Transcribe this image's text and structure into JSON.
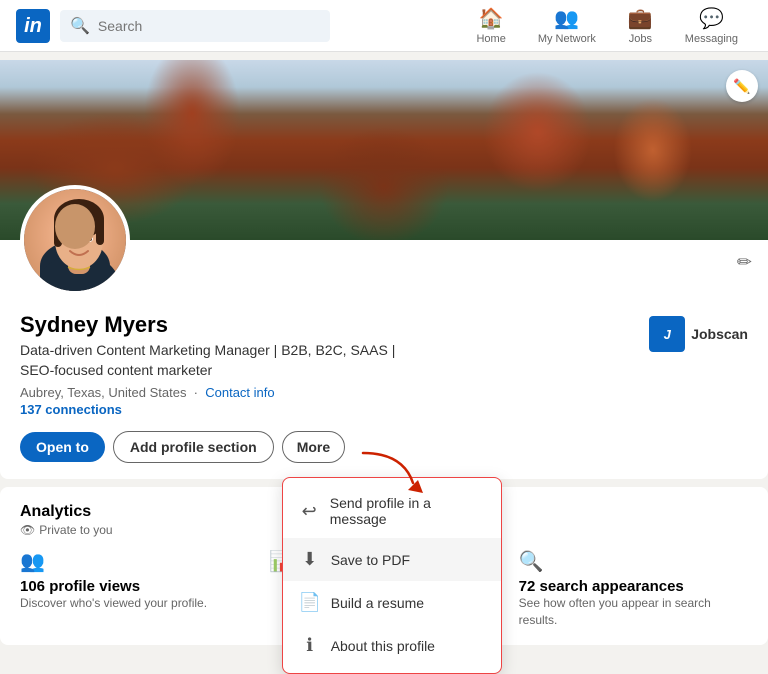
{
  "nav": {
    "logo": "in",
    "search_placeholder": "Search",
    "items": [
      {
        "label": "Home",
        "icon": "🏠"
      },
      {
        "label": "My Network",
        "icon": "👥"
      },
      {
        "label": "Jobs",
        "icon": "💼"
      },
      {
        "label": "Messaging",
        "icon": "💬"
      }
    ]
  },
  "profile": {
    "name": "Sydney Myers",
    "title": "Data-driven Content Marketing Manager | B2B, B2C, SAAS | SEO-focused content marketer",
    "location": "Aubrey, Texas, United States",
    "contact_info_label": "Contact info",
    "connections": "137 connections",
    "company": "Jobscan",
    "edit_label": "✏",
    "banner_edit_label": "✏"
  },
  "buttons": {
    "open_to": "Open to",
    "add_profile_section": "Add profile section",
    "more": "More"
  },
  "dropdown": {
    "items": [
      {
        "icon": "↩",
        "label": "Send profile in a message"
      },
      {
        "icon": "⬇",
        "label": "Save to PDF",
        "highlighted": true
      },
      {
        "icon": "📄",
        "label": "Build a resume"
      },
      {
        "icon": "ℹ",
        "label": "About this profile"
      }
    ]
  },
  "analytics": {
    "title": "Analytics",
    "subtitle": "Private to you",
    "eye_icon": "👁",
    "items": [
      {
        "icon": "👥",
        "count": "106 profile views",
        "desc": "Discover who's viewed your profile."
      },
      {
        "icon": "📊",
        "count": "",
        "desc": ""
      },
      {
        "icon": "🔍",
        "count": "72 search appearances",
        "desc": "See how often you appear in search results."
      }
    ]
  }
}
